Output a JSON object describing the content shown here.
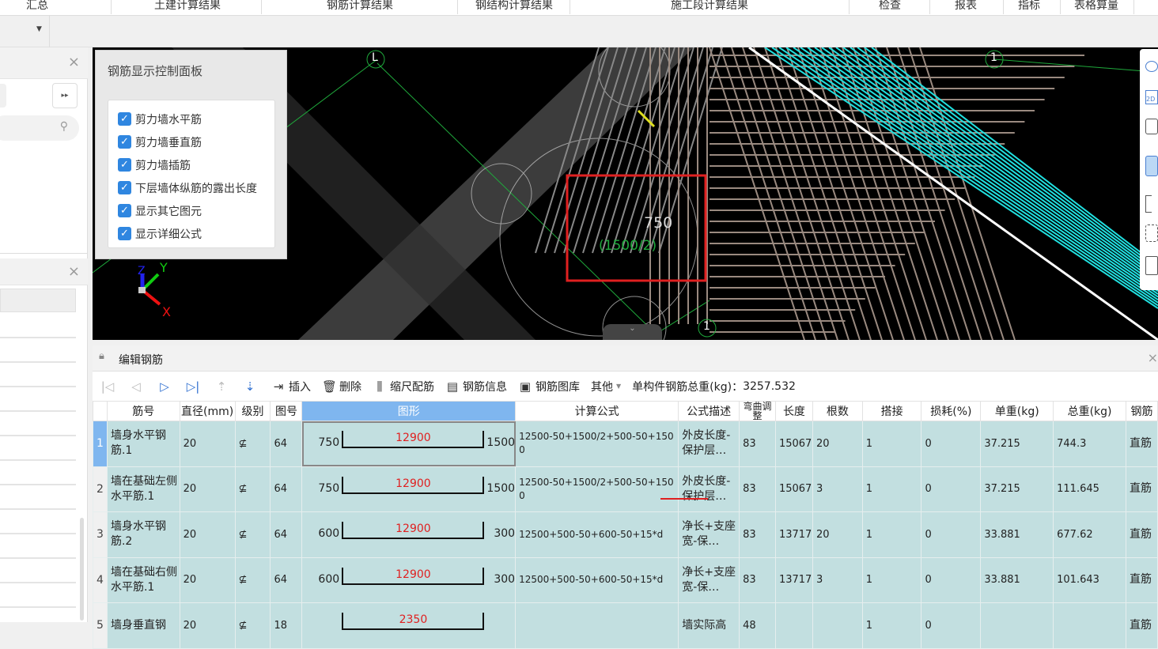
{
  "menubar": {
    "items": [
      "汇总",
      "土建计算结果",
      "钢筋计算结果",
      "钢结构计算结果",
      "施工段计算结果",
      "检查",
      "报表",
      "指标",
      "表格算量"
    ]
  },
  "viewport": {
    "axis_labels": {
      "l": "L",
      "one_top": "1",
      "one_bottom": "1"
    },
    "dimension_value": "750",
    "dimension_formula": "(1500/2)",
    "axes": {
      "x": "X",
      "y": "Y",
      "z": "Z"
    },
    "highlight_color": "#e02020"
  },
  "control_panel": {
    "title": "钢筋显示控制面板",
    "options": [
      {
        "label": "剪力墙水平筋",
        "checked": true
      },
      {
        "label": "剪力墙垂直筋",
        "checked": true
      },
      {
        "label": "剪力墙插筋",
        "checked": true
      },
      {
        "label": "下层墙体纵筋的露出长度",
        "checked": true
      },
      {
        "label": "显示其它图元",
        "checked": true
      },
      {
        "label": "显示详细公式",
        "checked": true
      }
    ]
  },
  "editor": {
    "title": "编辑钢筋",
    "toolbar": {
      "insert": "插入",
      "delete": "删除",
      "scale": "缩尺配筋",
      "info": "钢筋信息",
      "library": "钢筋图库",
      "other": "其他",
      "total_label": "单构件钢筋总重(kg)：",
      "total_value": "3257.532"
    },
    "columns": [
      "筋号",
      "直径(mm)",
      "级别",
      "图号",
      "图形",
      "计算公式",
      "公式描述",
      "弯曲调整",
      "长度",
      "根数",
      "搭接",
      "损耗(%)",
      "单重(kg)",
      "总重(kg)",
      "钢筋"
    ],
    "rows": [
      {
        "idx": "1",
        "name": "墙身水平钢筋.1",
        "dia": "20",
        "grade": "⊈",
        "fig": "64",
        "left": "750",
        "mid": "12900",
        "right": "1500",
        "formula": "12500-50+1500/2+500-50+1500",
        "desc": "外皮长度-保护层…",
        "bend": "83",
        "len": "15067",
        "count": "20",
        "lap": "1",
        "loss": "0",
        "unit": "37.215",
        "total": "744.3",
        "type": "直筋"
      },
      {
        "idx": "2",
        "name": "墙在基础左侧水平筋.1",
        "dia": "20",
        "grade": "⊈",
        "fig": "64",
        "left": "750",
        "mid": "12900",
        "right": "1500",
        "formula": "12500-50+1500/2+500-50+1500",
        "desc": "外皮长度-保护层…",
        "bend": "83",
        "len": "15067",
        "count": "3",
        "lap": "1",
        "loss": "0",
        "unit": "37.215",
        "total": "111.645",
        "type": "直筋"
      },
      {
        "idx": "3",
        "name": "墙身水平钢筋.2",
        "dia": "20",
        "grade": "⊈",
        "fig": "64",
        "left": "600",
        "mid": "12900",
        "right": "300",
        "formula": "12500+500-50+600-50+15*d",
        "desc": "净长+支座宽-保…",
        "bend": "83",
        "len": "13717",
        "count": "20",
        "lap": "1",
        "loss": "0",
        "unit": "33.881",
        "total": "677.62",
        "type": "直筋"
      },
      {
        "idx": "4",
        "name": "墙在基础右侧水平筋.1",
        "dia": "20",
        "grade": "⊈",
        "fig": "64",
        "left": "600",
        "mid": "12900",
        "right": "300",
        "formula": "12500+500-50+600-50+15*d",
        "desc": "净长+支座宽-保…",
        "bend": "83",
        "len": "13717",
        "count": "3",
        "lap": "1",
        "loss": "0",
        "unit": "33.881",
        "total": "101.643",
        "type": "直筋"
      },
      {
        "idx": "5",
        "name": "墙身垂直钢",
        "dia": "20",
        "grade": "⊈",
        "fig": "18",
        "left": "",
        "mid": "2350",
        "right": "",
        "formula": "",
        "desc": "墙实际高",
        "bend": "48",
        "len": "",
        "count": "",
        "lap": "1",
        "loss": "0",
        "unit": "",
        "total": "",
        "type": "直筋"
      }
    ]
  }
}
